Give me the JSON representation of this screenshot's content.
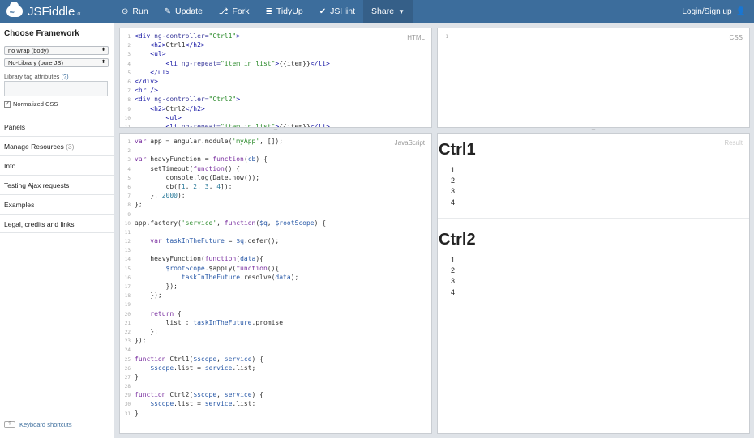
{
  "app": {
    "name": "JSFiddle",
    "alpha": "α"
  },
  "toolbar": {
    "run": "Run",
    "update": "Update",
    "fork": "Fork",
    "tidyup": "TidyUp",
    "jshint": "JSHint",
    "share": "Share",
    "login": "Login/Sign up"
  },
  "icons": {
    "run": "play-circle-icon",
    "update": "pencil-icon",
    "fork": "fork-icon",
    "tidyup": "tidy-icon",
    "jshint": "check-icon",
    "share": "chevron-down-icon",
    "login": "user-icon"
  },
  "sidebar": {
    "heading": "Choose Framework",
    "wrap_select": "no wrap (body)",
    "library_select": "No-Library (pure JS)",
    "tag_label": "Library tag attributes",
    "tag_help": "(?)",
    "tag_value": "",
    "normalized_css": "Normalized CSS",
    "normalized_checked": true,
    "sections": [
      {
        "label": "Panels",
        "count": ""
      },
      {
        "label": "Manage Resources",
        "count": "(3)"
      },
      {
        "label": "Info",
        "count": ""
      },
      {
        "label": "Testing Ajax requests",
        "count": ""
      },
      {
        "label": "Examples",
        "count": ""
      },
      {
        "label": "Legal, credits and links",
        "count": ""
      }
    ],
    "keyboard_key": "?",
    "keyboard_label": "Keyboard shortcuts"
  },
  "panels": {
    "html_label": "HTML",
    "css_label": "CSS",
    "js_label": "JavaScript",
    "result_label": "Result"
  },
  "html_code": {
    "line_numbers": [
      "1",
      "2",
      "3",
      "4",
      "5",
      "6",
      "7",
      "8",
      "9",
      "10",
      "11"
    ]
  },
  "css_code": {
    "line_numbers": [
      "1"
    ]
  },
  "js_code": {
    "line_numbers": [
      "1",
      "2",
      "3",
      "4",
      "5",
      "6",
      "7",
      "8",
      "9",
      "10",
      "11",
      "12",
      "13",
      "14",
      "15",
      "16",
      "17",
      "18",
      "19",
      "20",
      "21",
      "22",
      "23",
      "24",
      "25",
      "26",
      "27",
      "28",
      "29",
      "30",
      "31"
    ]
  },
  "result": {
    "ctrl1_title": "Ctrl1",
    "ctrl1_items": [
      "1",
      "2",
      "3",
      "4"
    ],
    "ctrl2_title": "Ctrl2",
    "ctrl2_items": [
      "1",
      "2",
      "3",
      "4"
    ]
  }
}
